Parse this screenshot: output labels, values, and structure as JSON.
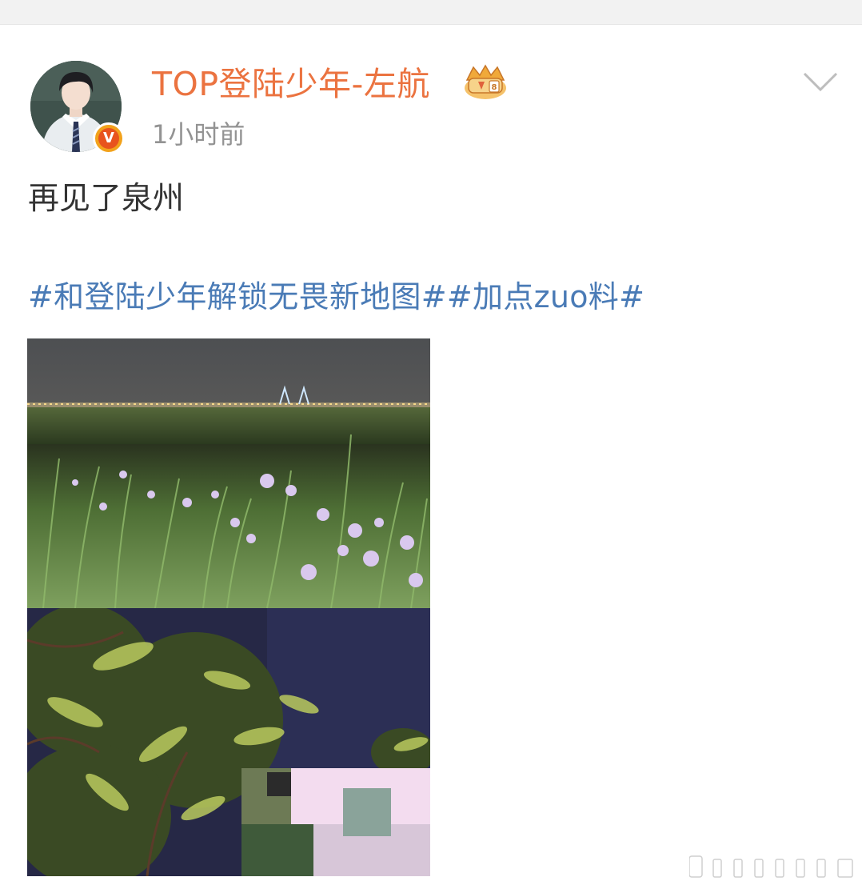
{
  "post": {
    "author": "TOP登陆少年-左航",
    "time": "1小时前",
    "text": "再见了泉州",
    "hashtags": "#和登陆少年解锁无畏新地图##加点zuo料#"
  },
  "icons": {
    "verified": "verified-v-badge-icon",
    "membership": "crown-membership-icon",
    "more": "chevron-down-icon"
  },
  "badge_letter": "V",
  "colors": {
    "author": "#eb7340",
    "hashtag": "#4a7bb6",
    "text": "#333333",
    "time": "#939393"
  }
}
